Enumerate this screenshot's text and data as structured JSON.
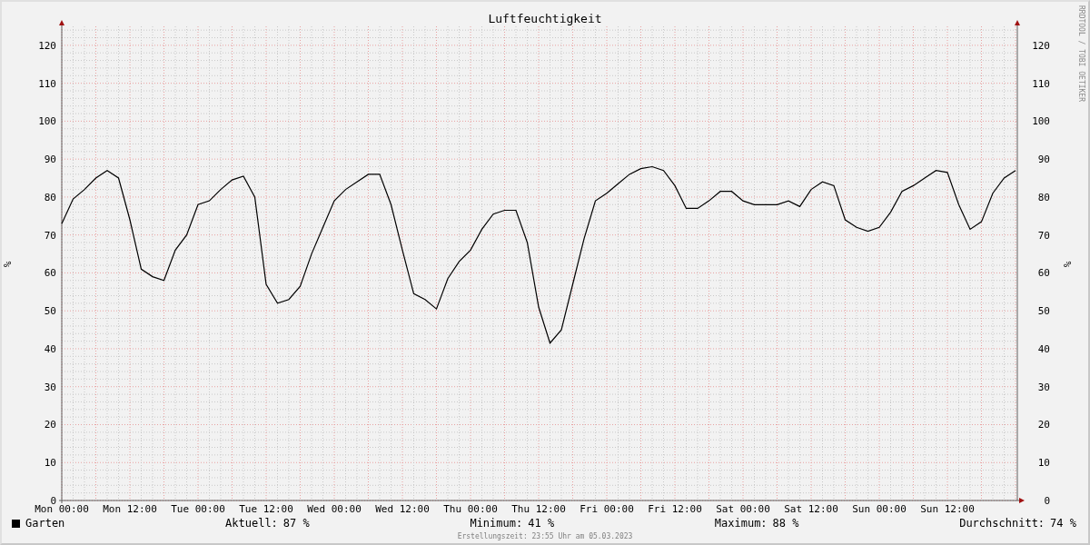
{
  "chart": {
    "watermark": "RRDTOOL / TOBI OETIKER",
    "unit_right": "%",
    "right_axis_labels": [
      "120",
      "110",
      "100",
      "90",
      "80",
      "70",
      "60",
      "50",
      "40",
      "30",
      "20",
      "10",
      "0"
    ],
    "chart_data": {
      "type": "line",
      "grid": true,
      "title": "Luftfeuchtigkeit",
      "ylabel": "%",
      "ylim": [
        0,
        125
      ],
      "yticks": [
        0,
        10,
        20,
        30,
        40,
        50,
        60,
        70,
        80,
        90,
        100,
        110,
        120
      ],
      "categories": [
        "Mon 00:00",
        null,
        null,
        null,
        null,
        null,
        "Mon 12:00",
        null,
        null,
        null,
        null,
        null,
        "Tue 00:00",
        null,
        null,
        null,
        null,
        null,
        "Tue 12:00",
        null,
        null,
        null,
        null,
        null,
        "Wed 00:00",
        null,
        null,
        null,
        null,
        null,
        "Wed 12:00",
        null,
        null,
        null,
        null,
        null,
        "Thu 00:00",
        null,
        null,
        null,
        null,
        null,
        "Thu 12:00",
        null,
        null,
        null,
        null,
        null,
        "Fri 00:00",
        null,
        null,
        null,
        null,
        null,
        "Fri 12:00",
        null,
        null,
        null,
        null,
        null,
        "Sat 00:00",
        null,
        null,
        null,
        null,
        null,
        "Sat 12:00",
        null,
        null,
        null,
        null,
        null,
        "Sun 00:00",
        null,
        null,
        null,
        null,
        null,
        "Sun 12:00",
        null,
        null,
        null,
        null,
        null,
        null
      ],
      "series": [
        {
          "name": "Garten",
          "color": "#000000",
          "values": [
            73,
            79.5,
            82,
            85,
            87,
            85,
            74,
            61,
            59,
            58,
            66,
            70,
            78,
            79,
            82,
            84.5,
            85.5,
            80,
            57,
            52,
            53,
            56.5,
            65,
            72,
            79,
            82,
            84,
            86,
            86,
            78,
            66,
            54.5,
            53,
            50.5,
            58.5,
            63,
            66,
            71.5,
            75.5,
            76.5,
            76.5,
            68,
            51,
            41.5,
            45,
            57,
            69,
            79,
            81,
            83.5,
            86,
            87.5,
            88,
            87,
            83,
            77,
            77,
            79,
            81.5,
            81.5,
            79,
            78,
            78,
            78,
            79,
            77.5,
            82,
            84,
            83,
            74,
            72,
            71,
            72,
            76,
            81.5,
            83,
            85,
            87,
            86.5,
            78,
            71.5,
            73.5,
            81,
            85,
            87
          ]
        }
      ]
    }
  },
  "legend": {
    "stats": [
      {
        "label": "Aktuell:",
        "value": "87 %"
      },
      {
        "label": "Minimum:",
        "value": "41 %"
      },
      {
        "label": "Maximum:",
        "value": "88 %"
      },
      {
        "label": "Durchschnitt:",
        "value": "74 %"
      }
    ]
  },
  "footer": "Erstellungszeit: 23:55 Uhr am 05.03.2023"
}
